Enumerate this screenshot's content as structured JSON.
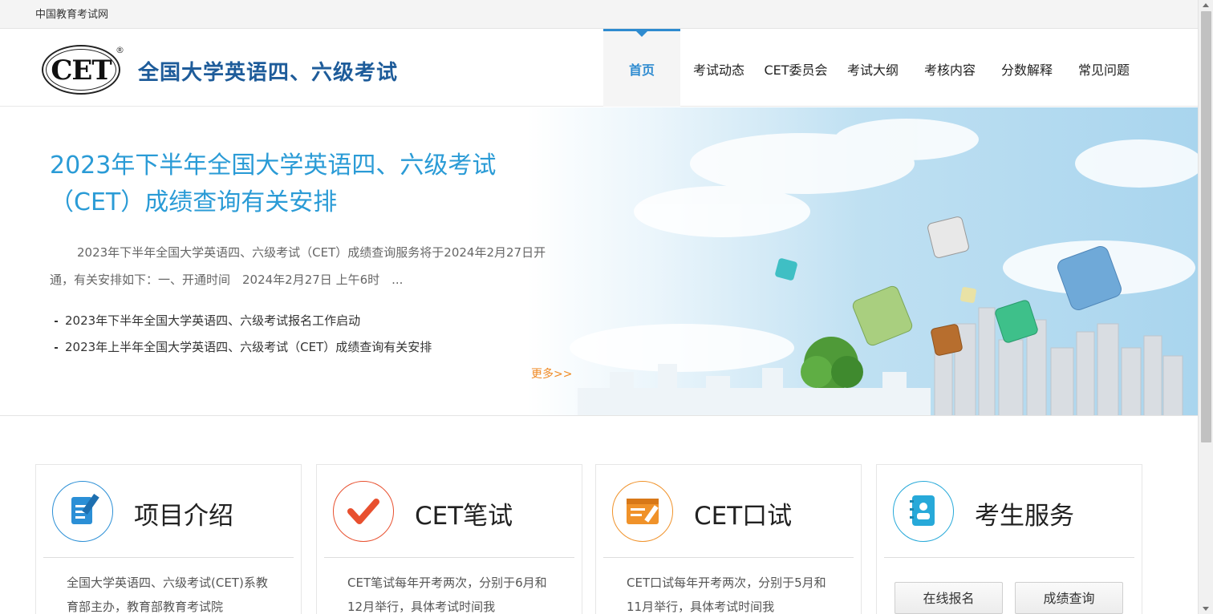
{
  "topbar": {
    "site_link": "中国教育考试网"
  },
  "header": {
    "logo_text": "CET",
    "logo_reg": "®",
    "site_title": "全国大学英语四、六级考试",
    "nav": [
      {
        "label": "首页",
        "active": true
      },
      {
        "label": "考试动态"
      },
      {
        "label": "CET委员会"
      },
      {
        "label": "考试大纲"
      },
      {
        "label": "考核内容"
      },
      {
        "label": "分数解释"
      },
      {
        "label": "常见问题"
      }
    ]
  },
  "banner": {
    "headline": "2023年下半年全国大学英语四、六级考试（CET）成绩查询有关安排",
    "summary": "2023年下半年全国大学英语四、六级考试（CET）成绩查询服务将于2024年2月27日开通，有关安排如下：一、开通时间　2024年2月27日 上午6时　...",
    "news": [
      "2023年下半年全国大学英语四、六级考试报名工作启动",
      "2023年上半年全国大学英语四、六级考试（CET）成绩查询有关安排"
    ],
    "more": "更多>>"
  },
  "cards": [
    {
      "title": "项目介绍",
      "text": "全国大学英语四、六级考试(CET)系教育部主办，教育部教育考试院",
      "icon": "document-edit-icon",
      "color": "#2b8fd6"
    },
    {
      "title": "CET笔试",
      "text": "CET笔试每年开考两次，分别于6月和12月举行，具体考试时间我",
      "icon": "checkmark-icon",
      "color": "#e8502f"
    },
    {
      "title": "CET口试",
      "text": "CET口试每年开考两次，分别于5月和11月举行，具体考试时间我",
      "icon": "browser-edit-icon",
      "color": "#f0922a"
    },
    {
      "title": "考生服务",
      "icon": "contact-book-icon",
      "color": "#27a9d9"
    }
  ],
  "services": {
    "register": "在线报名",
    "score_query": "成绩查询"
  }
}
